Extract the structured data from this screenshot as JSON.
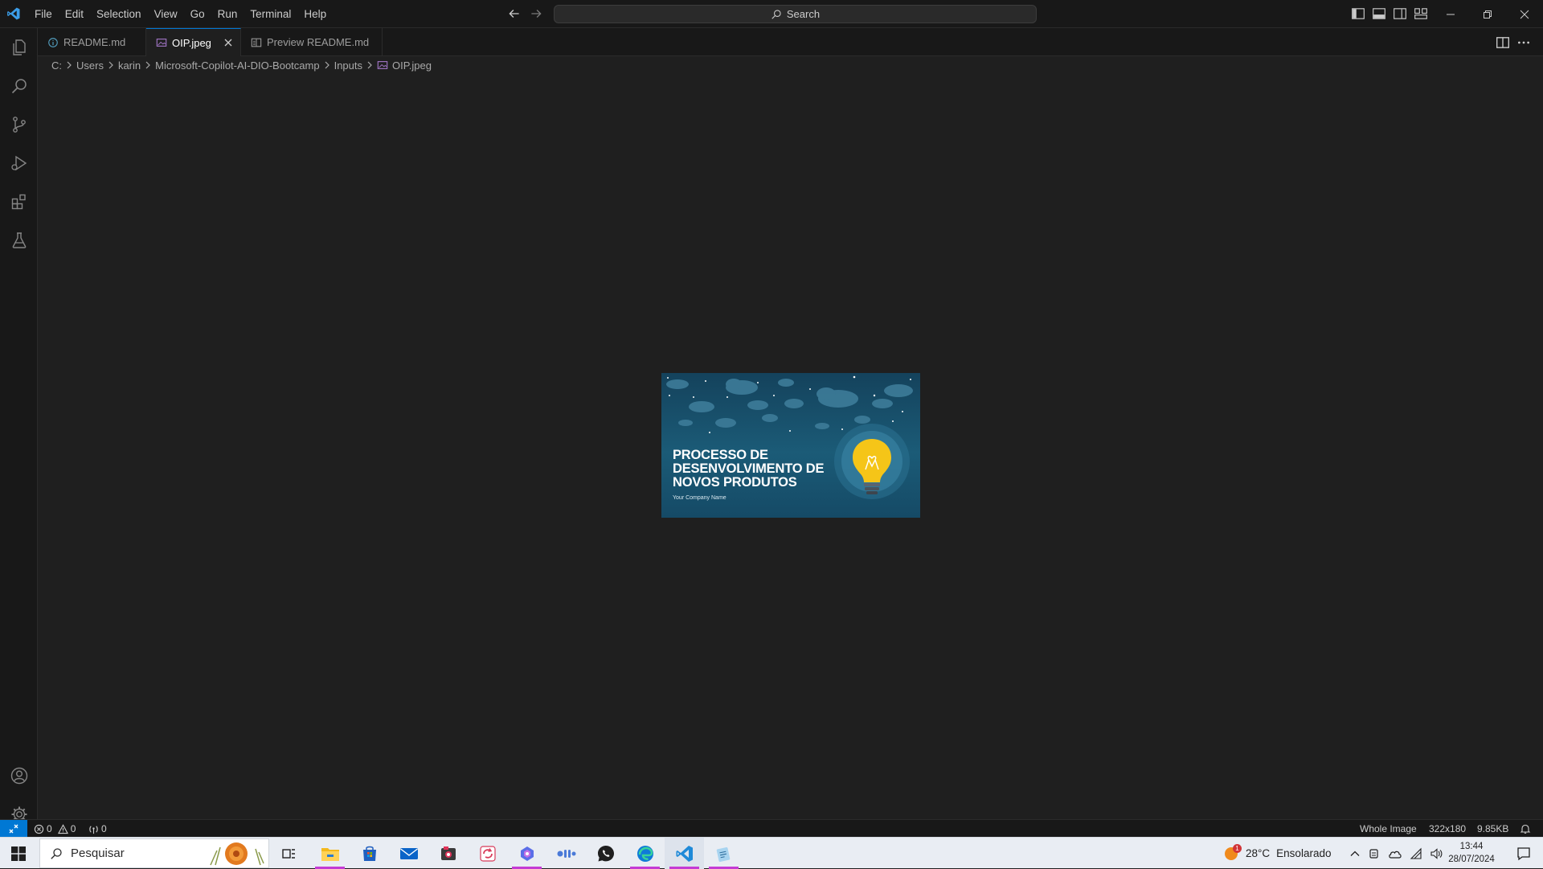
{
  "titlebar": {
    "menu": [
      "File",
      "Edit",
      "Selection",
      "View",
      "Go",
      "Run",
      "Terminal",
      "Help"
    ],
    "search_label": "Search"
  },
  "tabs": [
    {
      "label": "README.md",
      "icon": "info-icon",
      "active": false
    },
    {
      "label": "OIP.jpeg",
      "icon": "image-file-icon",
      "active": true
    },
    {
      "label": "Preview README.md",
      "icon": "preview-icon",
      "active": false
    }
  ],
  "breadcrumb": [
    "C:",
    "Users",
    "karin",
    "Microsoft-Copilot-AI-DIO-Bootcamp",
    "Inputs",
    "OIP.jpeg"
  ],
  "image_preview": {
    "title_line1": "PROCESSO DE",
    "title_line2": "DESENVOLVIMENTO DE",
    "title_line3": "NOVOS PRODUTOS",
    "subtitle": "Your Company Name"
  },
  "statusbar": {
    "errors": "0",
    "warnings": "0",
    "ports": "0",
    "zoom_label": "Whole Image",
    "dimensions": "322x180",
    "file_size": "9.85KB"
  },
  "taskbar": {
    "search_placeholder": "Pesquisar",
    "weather_temp": "28°C",
    "weather_desc": "Ensolarado",
    "weather_badge": "1",
    "time": "13:44",
    "date": "28/07/2024"
  },
  "colors": {
    "accent": "#0078d4",
    "editor_bg": "#1f1f1f",
    "chrome_bg": "#181818",
    "image_bg": "#1b5b77",
    "bulb_yellow": "#f5c518"
  }
}
